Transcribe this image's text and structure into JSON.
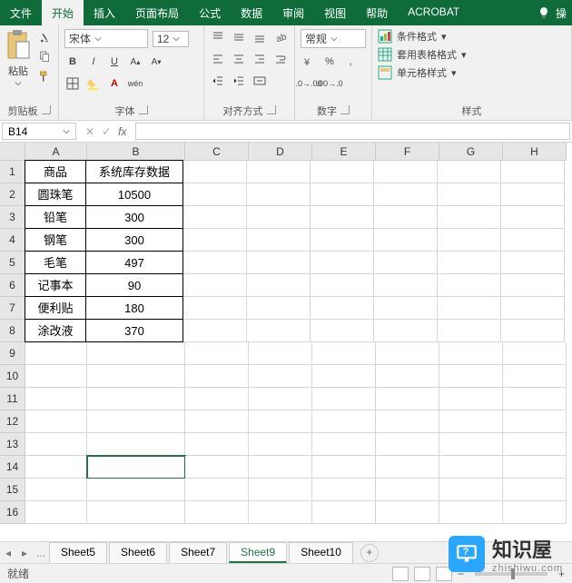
{
  "tabs": [
    "文件",
    "开始",
    "插入",
    "页面布局",
    "公式",
    "数据",
    "审阅",
    "视图",
    "帮助",
    "ACROBAT"
  ],
  "active_tab": 1,
  "help_action": "操",
  "ribbon": {
    "clipboard": {
      "label": "剪贴板",
      "paste": "粘贴"
    },
    "font": {
      "label": "字体",
      "name": "宋体",
      "size": "12"
    },
    "align": {
      "label": "对齐方式"
    },
    "number": {
      "label": "数字",
      "format": "常规"
    },
    "styles": {
      "label": "样式",
      "cond": "条件格式",
      "tbl": "套用表格格式",
      "cell": "单元格样式"
    }
  },
  "namebox": "B14",
  "columns": [
    "A",
    "B",
    "C",
    "D",
    "E",
    "F",
    "G",
    "H"
  ],
  "row_count": 16,
  "selected_cell": "B14",
  "chart_data": {
    "type": "table",
    "headers": [
      "商品",
      "系统库存数据"
    ],
    "rows": [
      [
        "圆珠笔",
        "10500"
      ],
      [
        "铅笔",
        "300"
      ],
      [
        "钢笔",
        "300"
      ],
      [
        "毛笔",
        "497"
      ],
      [
        "记事本",
        "90"
      ],
      [
        "便利贴",
        "180"
      ],
      [
        "涂改液",
        "370"
      ]
    ]
  },
  "sheets": [
    "Sheet5",
    "Sheet6",
    "Sheet7",
    "Sheet9",
    "Sheet10"
  ],
  "active_sheet": "Sheet9",
  "ellipsis": "...",
  "status": "就绪",
  "watermark": {
    "brand": "知识屋",
    "url": "zhishiwu.com"
  }
}
